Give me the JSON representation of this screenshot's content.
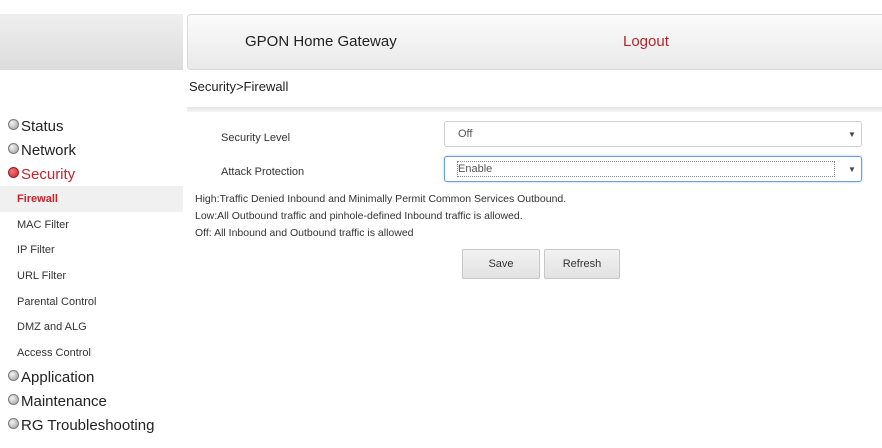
{
  "header": {
    "title": "GPON Home Gateway",
    "logout": "Logout"
  },
  "breadcrumb": "Security>Firewall",
  "sidebar": {
    "items": [
      {
        "label": "Status",
        "icon": "expand-circle-icon"
      },
      {
        "label": "Network",
        "icon": "expand-circle-icon"
      },
      {
        "label": "Security",
        "icon": "collapse-circle-icon",
        "active": true,
        "children": [
          "Firewall",
          "MAC Filter",
          "IP Filter",
          "URL Filter",
          "Parental Control",
          "DMZ and ALG",
          "Access Control"
        ],
        "active_child": "Firewall"
      },
      {
        "label": "Application",
        "icon": "expand-circle-icon"
      },
      {
        "label": "Maintenance",
        "icon": "expand-circle-icon"
      },
      {
        "label": "RG Troubleshooting",
        "icon": "expand-circle-icon"
      }
    ]
  },
  "form": {
    "security_level": {
      "label": "Security Level",
      "value": "Off"
    },
    "attack_protection": {
      "label": "Attack Protection",
      "value": "Enable"
    }
  },
  "notes": [
    "High:Traffic Denied Inbound and Minimally Permit Common Services Outbound.",
    "Low:All Outbound traffic and pinhole-defined Inbound traffic is allowed.",
    "Off: All Inbound and Outbound traffic is allowed"
  ],
  "buttons": {
    "save": "Save",
    "refresh": "Refresh"
  },
  "colors": {
    "accent": "#c8232a",
    "logout": "#b3262b"
  }
}
